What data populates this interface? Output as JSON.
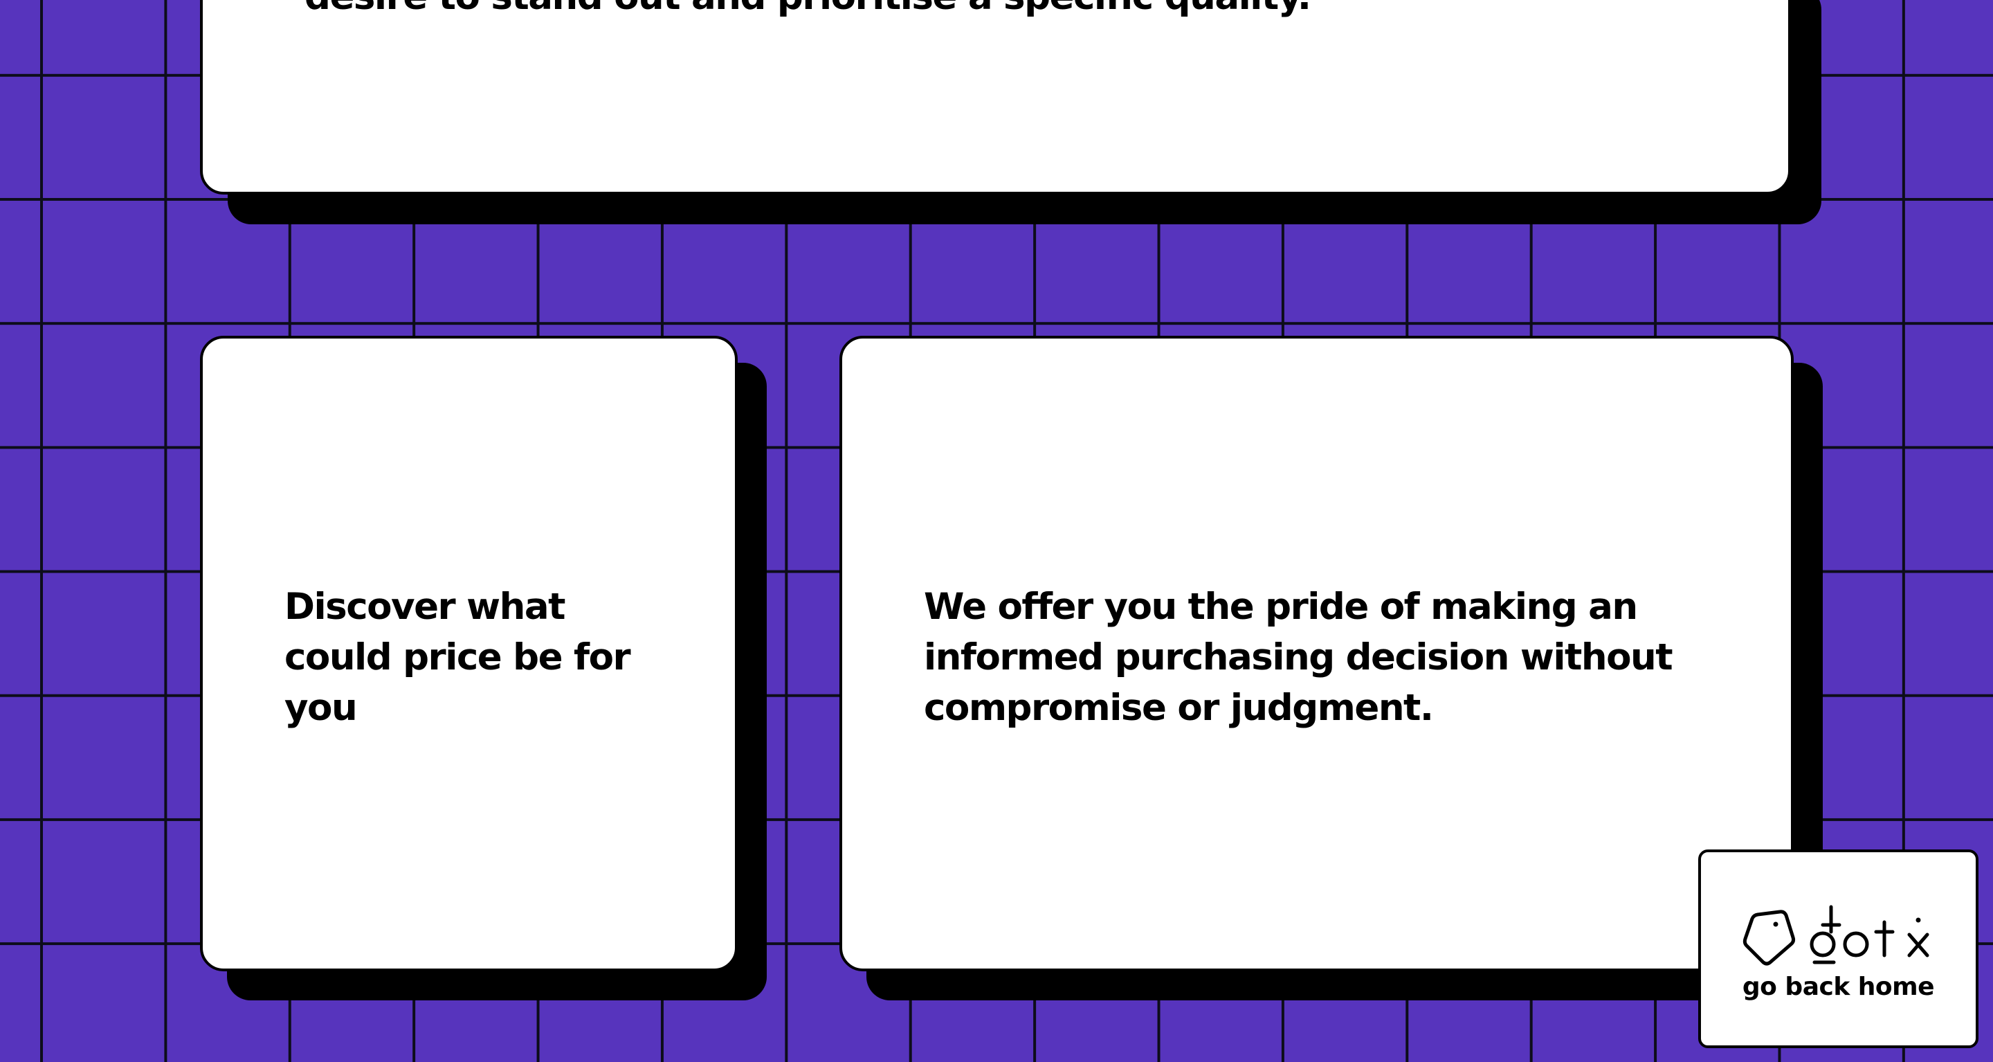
{
  "cards": {
    "top": {
      "text": "desire to stand out and prioritise a specific quality."
    },
    "left": {
      "text": "Discover what could price be for you"
    },
    "right": {
      "text": "We offer you the pride of making an informed purchasing decision without compromise or judgment."
    }
  },
  "home_widget": {
    "logo_text": "dot x",
    "label": "go back home",
    "logo_icon": "rounded-pentagon-icon"
  },
  "colors": {
    "background": "#5734bd",
    "grid_lines": "#0d0d1a",
    "card": "#ffffff",
    "card_shadow": "#000000"
  }
}
